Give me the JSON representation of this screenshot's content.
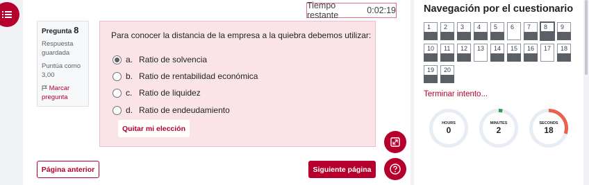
{
  "timer": {
    "label": "Tiempo restante",
    "value": "0:02:19"
  },
  "question_info": {
    "title_prefix": "Pregunta",
    "number": "8",
    "state": "Respuesta guardada",
    "grade_label": "Puntúa como",
    "grade_value": "3,00",
    "flag_label": "Marcar pregunta"
  },
  "question": {
    "text": "Para conocer la distancia de la empresa a la quiebra debemos utilizar:",
    "answers": [
      {
        "letter": "a.",
        "text": "Ratio de solvencia",
        "selected": true
      },
      {
        "letter": "b.",
        "text": "Ratio de rentabilidad económica",
        "selected": false
      },
      {
        "letter": "c.",
        "text": "Ratio de liquidez",
        "selected": false
      },
      {
        "letter": "d.",
        "text": "Ratio de endeudamiento",
        "selected": false
      }
    ],
    "clear_label": "Quitar mi elección"
  },
  "nav_buttons": {
    "prev_label": "Página anterior",
    "next_label": "Siguiente página"
  },
  "quiz_nav": {
    "title": "Navegación por el cuestionario",
    "questions": [
      {
        "num": "1",
        "state": "answered"
      },
      {
        "num": "2",
        "state": "answered"
      },
      {
        "num": "3",
        "state": "answered"
      },
      {
        "num": "4",
        "state": "answered"
      },
      {
        "num": "5",
        "state": "answered"
      },
      {
        "num": "6",
        "state": "empty"
      },
      {
        "num": "7",
        "state": "answered"
      },
      {
        "num": "8",
        "state": "current"
      },
      {
        "num": "9",
        "state": "answered"
      },
      {
        "num": "10",
        "state": "answered"
      },
      {
        "num": "11",
        "state": "answered"
      },
      {
        "num": "12",
        "state": "answered"
      },
      {
        "num": "13",
        "state": "empty"
      },
      {
        "num": "14",
        "state": "answered"
      },
      {
        "num": "15",
        "state": "answered"
      },
      {
        "num": "16",
        "state": "answered"
      },
      {
        "num": "17",
        "state": "empty"
      },
      {
        "num": "18",
        "state": "answered"
      },
      {
        "num": "19",
        "state": "answered"
      },
      {
        "num": "20",
        "state": "answered"
      }
    ],
    "finish_label": "Terminar intento..."
  },
  "countdown": [
    {
      "label": "HOURS",
      "value": "0",
      "fraction": 0,
      "color": "#2e9e4f"
    },
    {
      "label": "MINUTES",
      "value": "2",
      "fraction": 0.033,
      "color": "#2e9e4f"
    },
    {
      "label": "SECONDS",
      "value": "18",
      "fraction": 0.3,
      "color": "#e8624d"
    }
  ],
  "colors": {
    "accent": "#b5002d",
    "track": "#e8ecf5"
  },
  "icons": {
    "drawer": "list-icon",
    "fullscreen": "expand-icon",
    "help": "question-icon",
    "flag": "flag-icon"
  }
}
